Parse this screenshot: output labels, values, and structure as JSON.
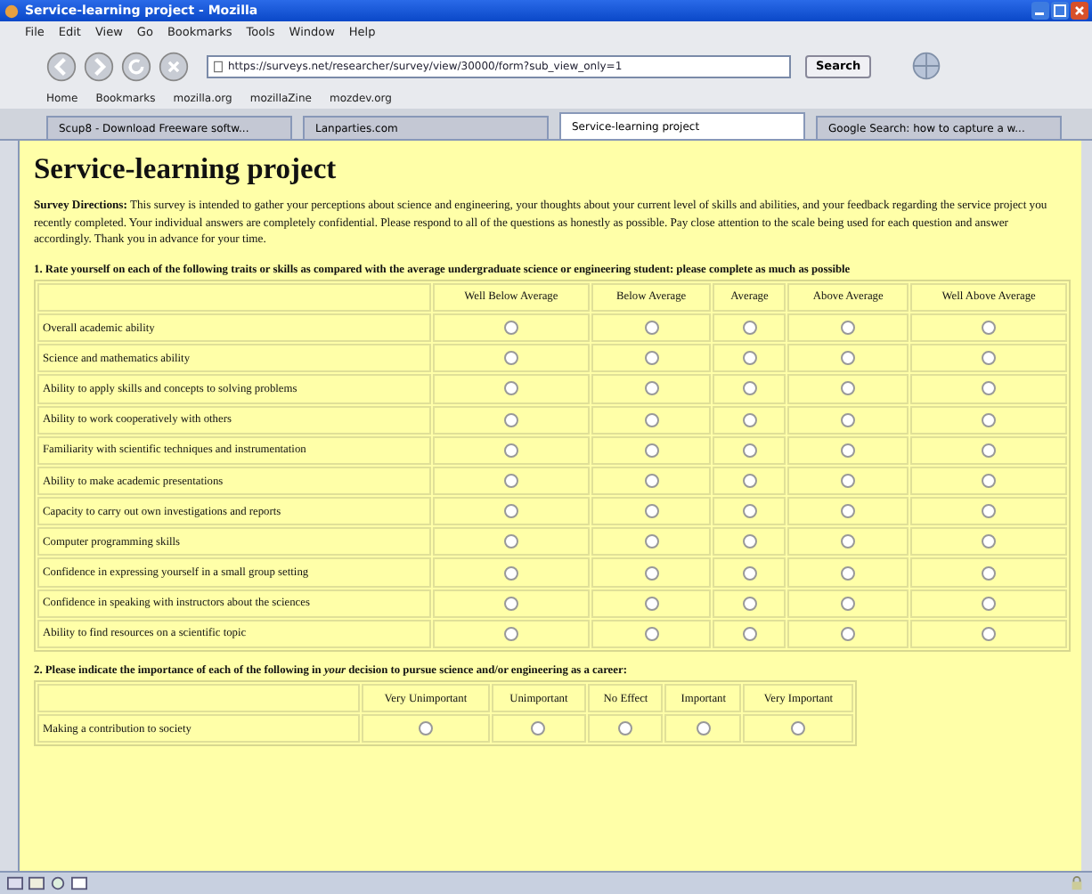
{
  "window": {
    "title": "Service-learning project - Mozilla"
  },
  "menu": [
    "File",
    "Edit",
    "View",
    "Go",
    "Bookmarks",
    "Tools",
    "Window",
    "Help"
  ],
  "address": {
    "value": "https://surveys.net/researcher/survey/view/30000/form?sub_view_only=1"
  },
  "search_button": "Search",
  "bookmarks": [
    "Home",
    "Bookmarks",
    "mozilla.org",
    "mozillaZine",
    "mozdev.org"
  ],
  "tabs": [
    {
      "label": "Scup8 - Download Freeware softw...",
      "selected": false
    },
    {
      "label": "Lanparties.com",
      "selected": false
    },
    {
      "label": "Service-learning project",
      "selected": true
    },
    {
      "label": "Google Search: how to capture a w...",
      "selected": false
    }
  ],
  "page": {
    "heading": "Service-learning project",
    "directions": "**Survey Directions:** This survey is intended to gather your perceptions about science and engineering, your thoughts about your current level of skills and abilities, and your feedback regarding the service project you recently completed. Your individual answers are completely confidential. Please respond to all of the questions as honestly as possible. Pay close attention to the scale being used for each question and answer accordingly. Thank you in advance for your time.",
    "questions": [
      {
        "text": "1. Rate yourself on each of the following traits or skills as compared with the average undergraduate science or engineering student: please complete as much as possible",
        "columns": [
          "Well Below Average",
          "Below Average",
          "Average",
          "Above Average",
          "Well Above Average"
        ],
        "rows": [
          {
            "label": "Overall academic ability",
            "checked": [
              false,
              false,
              false,
              false,
              false
            ]
          },
          {
            "label": "Science and mathematics ability",
            "checked": [
              false,
              false,
              false,
              false,
              false
            ]
          },
          {
            "label": "Ability to apply skills and concepts to solving problems",
            "checked": [
              false,
              false,
              false,
              false,
              false
            ]
          },
          {
            "label": "Ability to work cooperatively with others",
            "checked": [
              false,
              false,
              false,
              false,
              false
            ]
          },
          {
            "label": "Familiarity with scientific techniques and instrumentation",
            "checked": [
              false,
              false,
              false,
              false,
              false
            ]
          },
          {
            "label": "Ability to make academic presentations",
            "checked": [
              false,
              false,
              false,
              false,
              false
            ]
          },
          {
            "label": "Capacity to carry out own investigations and reports",
            "checked": [
              false,
              false,
              false,
              false,
              false
            ]
          },
          {
            "label": "Computer programming skills",
            "checked": [
              false,
              false,
              false,
              false,
              false
            ]
          },
          {
            "label": "Confidence in expressing yourself in a small group setting",
            "checked": [
              false,
              false,
              false,
              false,
              false
            ]
          },
          {
            "label": "Confidence in speaking with instructors about the sciences",
            "checked": [
              false,
              false,
              false,
              false,
              false
            ]
          },
          {
            "label": "Ability to find resources on a scientific topic",
            "checked": [
              false,
              false,
              false,
              false,
              false
            ]
          }
        ]
      },
      {
        "text": "2. Please indicate the importance of each of the following in *your* decision to pursue science and/or engineering as a career:",
        "columns": [
          "Very Unimportant",
          "Unimportant",
          "No Effect",
          "Important",
          "Very Important"
        ],
        "rows": [
          {
            "label": "Making a contribution to society",
            "checked": [
              false,
              false,
              false,
              false,
              false
            ]
          }
        ]
      }
    ]
  }
}
